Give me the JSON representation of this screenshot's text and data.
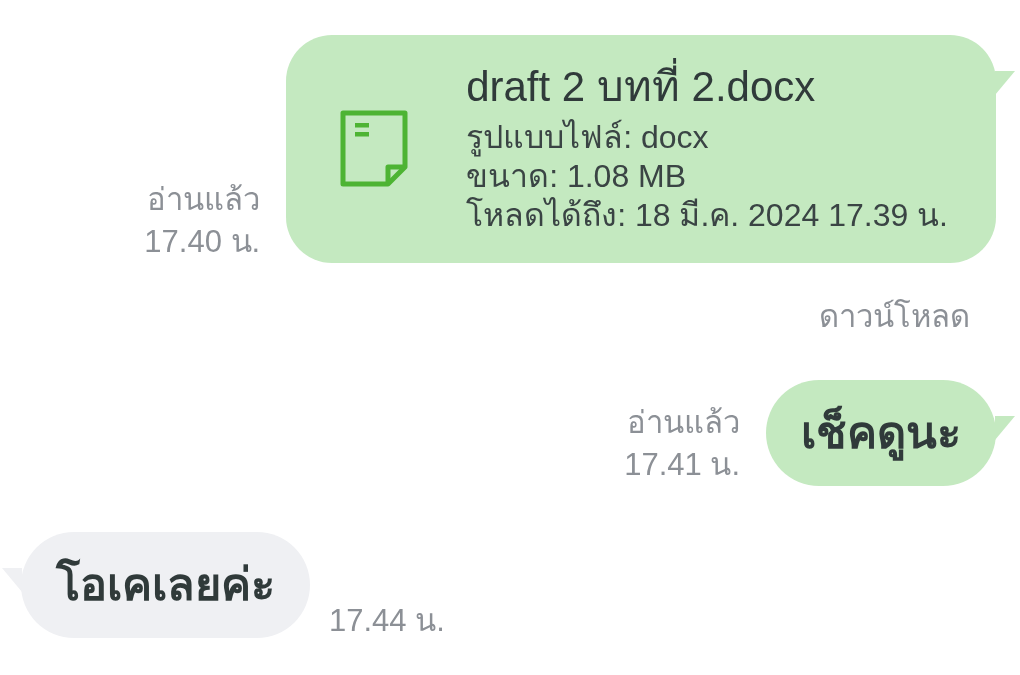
{
  "messages": [
    {
      "outgoing": true,
      "kind": "file",
      "file": {
        "name": "draft 2 บทที่ 2.docx",
        "details": [
          "รูปแบบไฟล์: docx",
          "ขนาด: 1.08 MB",
          "โหลดได้ถึง: 18 มี.ค. 2024 17.39 น."
        ]
      },
      "status": "อ่านแล้ว",
      "time": "17.40 น.",
      "action": "ดาวน์โหลด"
    },
    {
      "outgoing": true,
      "kind": "text",
      "text": "เช็คดูนะ",
      "status": "อ่านแล้ว",
      "time": "17.41 น."
    },
    {
      "outgoing": false,
      "kind": "text",
      "text": "โอเคเลยค่ะ",
      "time": "17.44 น."
    }
  ]
}
